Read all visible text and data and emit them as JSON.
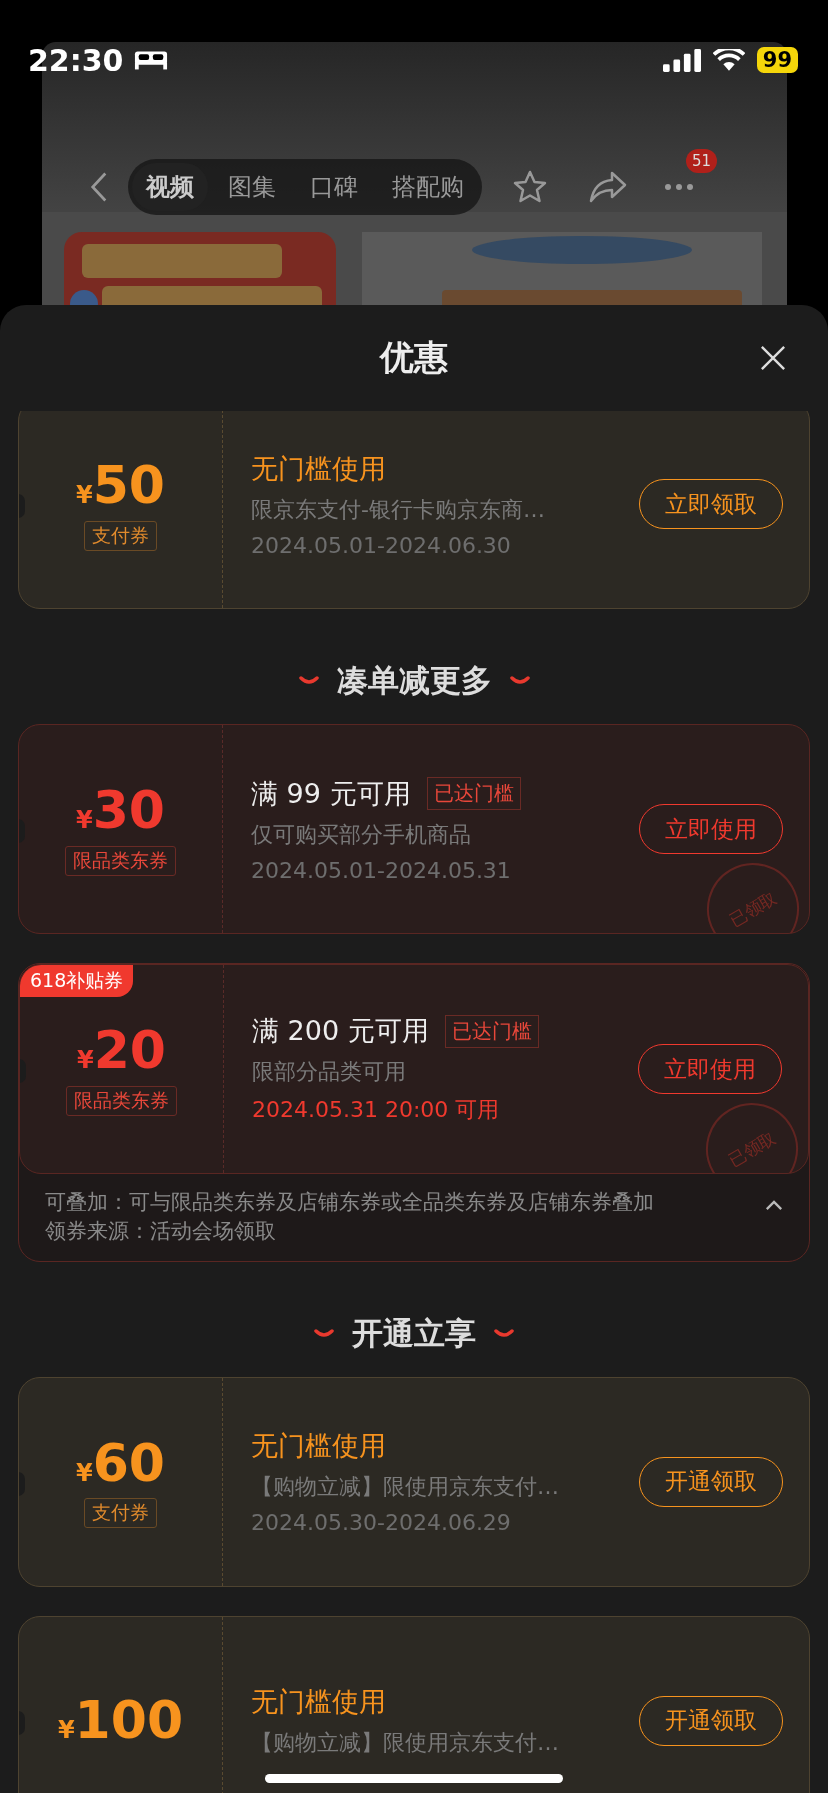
{
  "status_bar": {
    "time": "22:30",
    "battery": "99"
  },
  "background_page": {
    "tabs": [
      {
        "label": "视频",
        "selected": true
      },
      {
        "label": "图集",
        "selected": false
      },
      {
        "label": "口碑",
        "selected": false
      },
      {
        "label": "搭配购",
        "selected": false
      }
    ],
    "more_badge": "51"
  },
  "sheet": {
    "title": "优惠"
  },
  "sections": [
    {
      "coupons": [
        {
          "kind": "pay",
          "currency": "¥",
          "amount": "50",
          "tag": "支付券",
          "title": "无门槛使用",
          "desc": "限京东支付-银行卡购京东商…",
          "date": "2024.05.01-2024.06.30",
          "date_highlight": false,
          "button": "立即领取"
        }
      ]
    },
    {
      "heading": "凑单减更多",
      "coupons": [
        {
          "kind": "category",
          "currency": "¥",
          "amount": "30",
          "tag": "限品类东券",
          "title": "满 99 元可用",
          "badge": "已达门槛",
          "desc": "仅可购买部分手机商品",
          "date": "2024.05.01-2024.05.31",
          "date_highlight": false,
          "button": "立即使用",
          "claimed_stamp": "已领取"
        },
        {
          "kind": "category",
          "ribbon": "618补贴券",
          "currency": "¥",
          "amount": "20",
          "tag": "限品类东券",
          "title": "满 200 元可用",
          "badge": "已达门槛",
          "desc": "限部分品类可用",
          "date": "2024.05.31 20:00 可用",
          "date_highlight": true,
          "button": "立即使用",
          "claimed_stamp": "已领取",
          "details": {
            "expanded": true,
            "lines": [
              "可叠加：可与限品类东券及店铺东券或全品类东券及店铺东券叠加",
              "领券来源：活动会场领取"
            ]
          }
        }
      ]
    },
    {
      "heading": "开通立享",
      "coupons": [
        {
          "kind": "pay",
          "currency": "¥",
          "amount": "60",
          "tag": "支付券",
          "title": "无门槛使用",
          "desc": "【购物立减】限使用京东支付…",
          "date": "2024.05.30-2024.06.29",
          "date_highlight": false,
          "button": "开通领取"
        },
        {
          "kind": "pay",
          "currency": "¥",
          "amount": "100",
          "title": "无门槛使用",
          "desc": "【购物立减】限使用京东支付…",
          "button": "开通领取"
        }
      ]
    }
  ]
}
